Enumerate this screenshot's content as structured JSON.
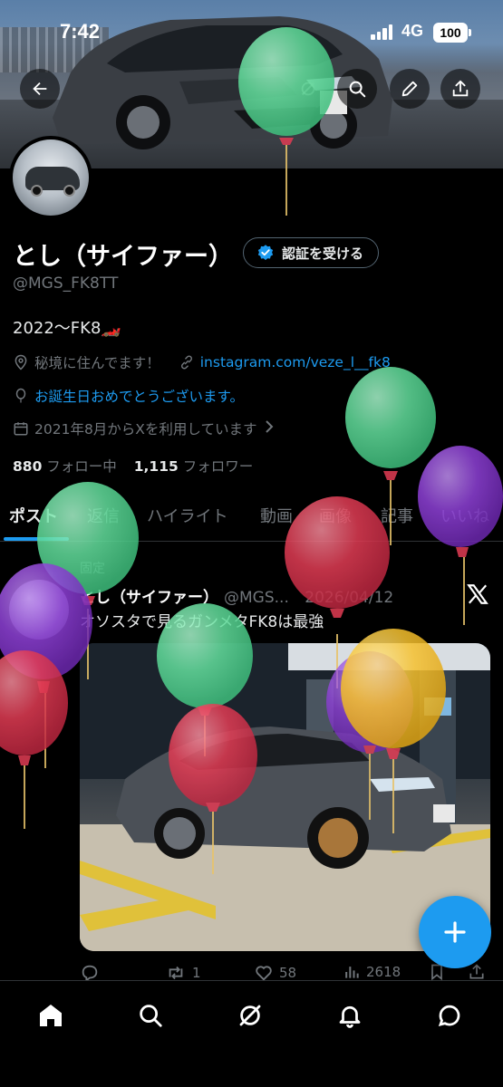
{
  "status_bar": {
    "time": "7:42",
    "network": "4G",
    "battery": "100"
  },
  "profile": {
    "display_name": "とし（サイファー）",
    "verify_button": "認証を受ける",
    "handle": "@MGS_FK8TT",
    "bio": "2022〜FK8🏎️",
    "location": "秘境に住んでます！",
    "website": "instagram.com/veze_l__fk8",
    "birthday": "お誕生日おめでとうございます。",
    "joined": "2021年8月からXを利用しています",
    "following_count": "880",
    "following_label": "フォロー中",
    "followers_count": "1,115",
    "followers_label": "フォロワー"
  },
  "tabs": [
    {
      "label": "ポスト"
    },
    {
      "label": "返信"
    },
    {
      "label": "ハイライト"
    },
    {
      "label": "動画"
    },
    {
      "label": "画像"
    },
    {
      "label": "記事"
    },
    {
      "label": "いいね"
    }
  ],
  "post": {
    "pinned_label": "固定",
    "author_name": "とし（サイファー）",
    "author_handle": "@MGS...",
    "date": "2026/04/12",
    "text": "オソスタで見るガンメタFK8は最強",
    "replies": "",
    "reposts": "1",
    "likes": "58",
    "views": "2618"
  },
  "icons": {
    "back": "arrow-left-icon",
    "search": "search-icon",
    "edit": "pencil-icon",
    "share": "share-icon",
    "grok": "grok-icon",
    "x_logo": "x-logo-icon"
  },
  "colors": {
    "accent": "#1d9bf0",
    "background": "#000000",
    "text_primary": "#e7e9ea",
    "text_secondary": "#71767b",
    "balloon_green": "#5ee0a0",
    "balloon_purple": "#8e3fd6",
    "balloon_red": "#e23a52",
    "balloon_yellow": "#f5c030"
  }
}
